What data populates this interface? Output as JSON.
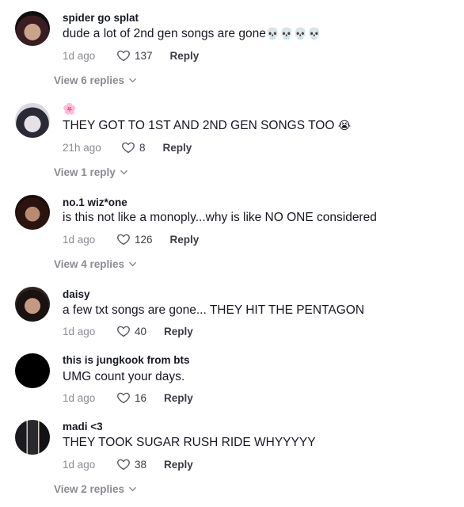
{
  "comments": [
    {
      "username": "spider go splat",
      "text": "dude a lot of 2nd gen songs are gone",
      "emoji": "💀💀💀💀",
      "time": "1d ago",
      "likes": "137",
      "reply_label": "Reply",
      "view_replies": "View 6 replies"
    },
    {
      "username": "🌸",
      "text": "THEY GOT TO 1ST AND 2ND GEN SONGS TOO",
      "emoji": "😭",
      "time": "21h ago",
      "likes": "8",
      "reply_label": "Reply",
      "view_replies": "View 1 reply"
    },
    {
      "username": "no.1 wiz*one",
      "text": "is this not like a monoply...why is like NO ONE considered",
      "emoji": "",
      "time": "1d ago",
      "likes": "126",
      "reply_label": "Reply",
      "view_replies": "View 4 replies"
    },
    {
      "username": "daisy",
      "text": "a few txt songs are gone... THEY HIT THE PENTAGON",
      "emoji": "",
      "time": "1d ago",
      "likes": "40",
      "reply_label": "Reply"
    },
    {
      "username": "this is jungkook from bts",
      "text": "UMG count your days.",
      "emoji": "",
      "time": "1d ago",
      "likes": "16",
      "reply_label": "Reply"
    },
    {
      "username": "madi <3",
      "text": "THEY TOOK SUGAR RUSH RIDE WHYYYYY",
      "emoji": "",
      "time": "1d ago",
      "likes": "38",
      "reply_label": "Reply",
      "view_replies": "View 2 replies"
    }
  ]
}
